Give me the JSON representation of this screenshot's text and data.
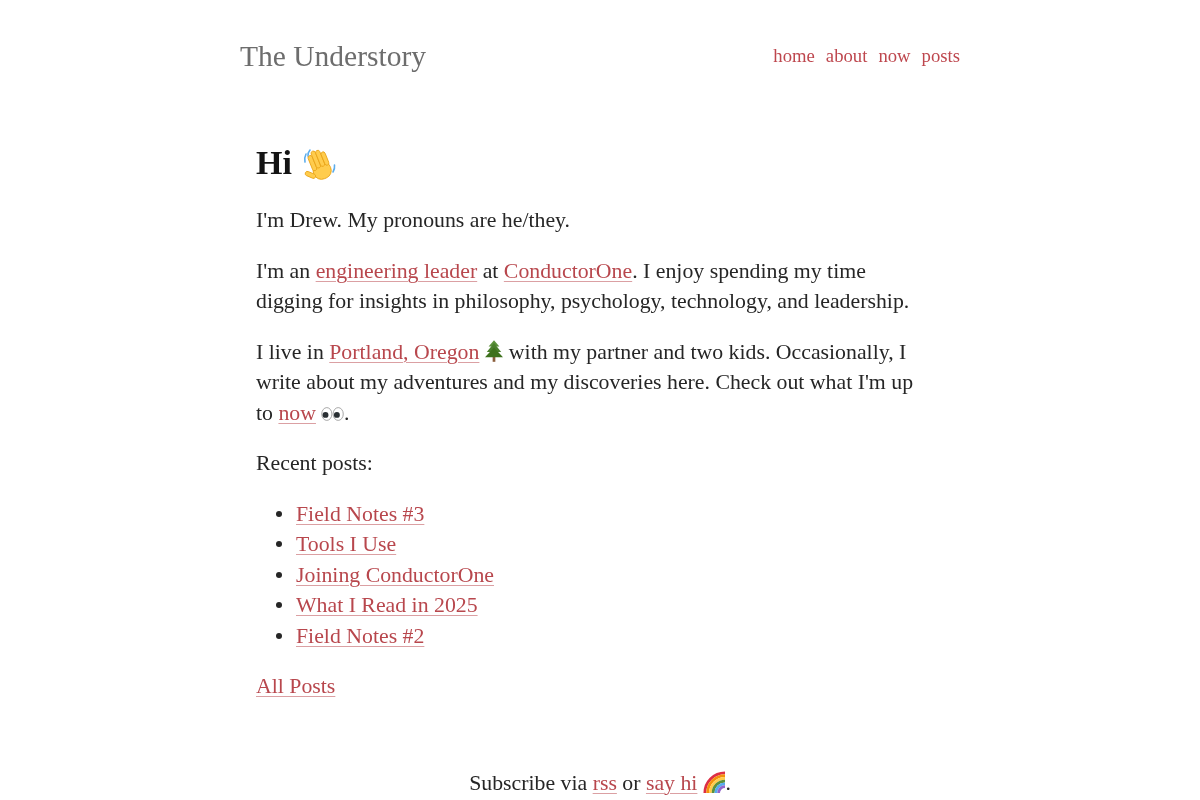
{
  "header": {
    "site_title": "The Understory",
    "nav": [
      "home",
      "about",
      "now",
      "posts"
    ]
  },
  "main": {
    "heading": [
      {
        "kind": "text",
        "text": "Hi"
      },
      {
        "kind": "wave"
      }
    ],
    "paragraphs": [
      {
        "segments": [
          {
            "kind": "text",
            "text": "I'm Drew. My pronouns are he/they."
          }
        ]
      },
      {
        "segments": [
          {
            "kind": "text",
            "text": "I'm an "
          },
          {
            "kind": "link",
            "text": "engineering leader"
          },
          {
            "kind": "text",
            "text": " at "
          },
          {
            "kind": "link",
            "text": "ConductorOne"
          },
          {
            "kind": "text",
            "text": ". I enjoy spending my time digging for insights in philosophy, psychology, technology, and leadership."
          }
        ]
      },
      {
        "segments": [
          {
            "kind": "text",
            "text": "I live in "
          },
          {
            "kind": "link",
            "text": "Portland, Oregon"
          },
          {
            "kind": "tree"
          },
          {
            "kind": "text",
            "text": " with my partner and two kids. Occasionally, I write about my adventures and my discoveries here. Check out what I'm up to "
          },
          {
            "kind": "link",
            "text": "now"
          },
          {
            "kind": "eyes"
          },
          {
            "kind": "text",
            "text": "."
          }
        ]
      }
    ],
    "recent_posts": {
      "label": "Recent posts:",
      "items": [
        "Field Notes #3",
        "Tools I Use",
        "Joining ConductorOne",
        "What I Read in 2025",
        "Field Notes #2"
      ]
    },
    "all_posts_link": "All Posts"
  },
  "footer": [
    {
      "kind": "text",
      "text": "Subscribe via "
    },
    {
      "kind": "link",
      "text": "rss"
    },
    {
      "kind": "text",
      "text": " or "
    },
    {
      "kind": "link",
      "text": "say hi"
    },
    {
      "kind": "rainbow"
    },
    {
      "kind": "text",
      "text": "."
    }
  ]
}
